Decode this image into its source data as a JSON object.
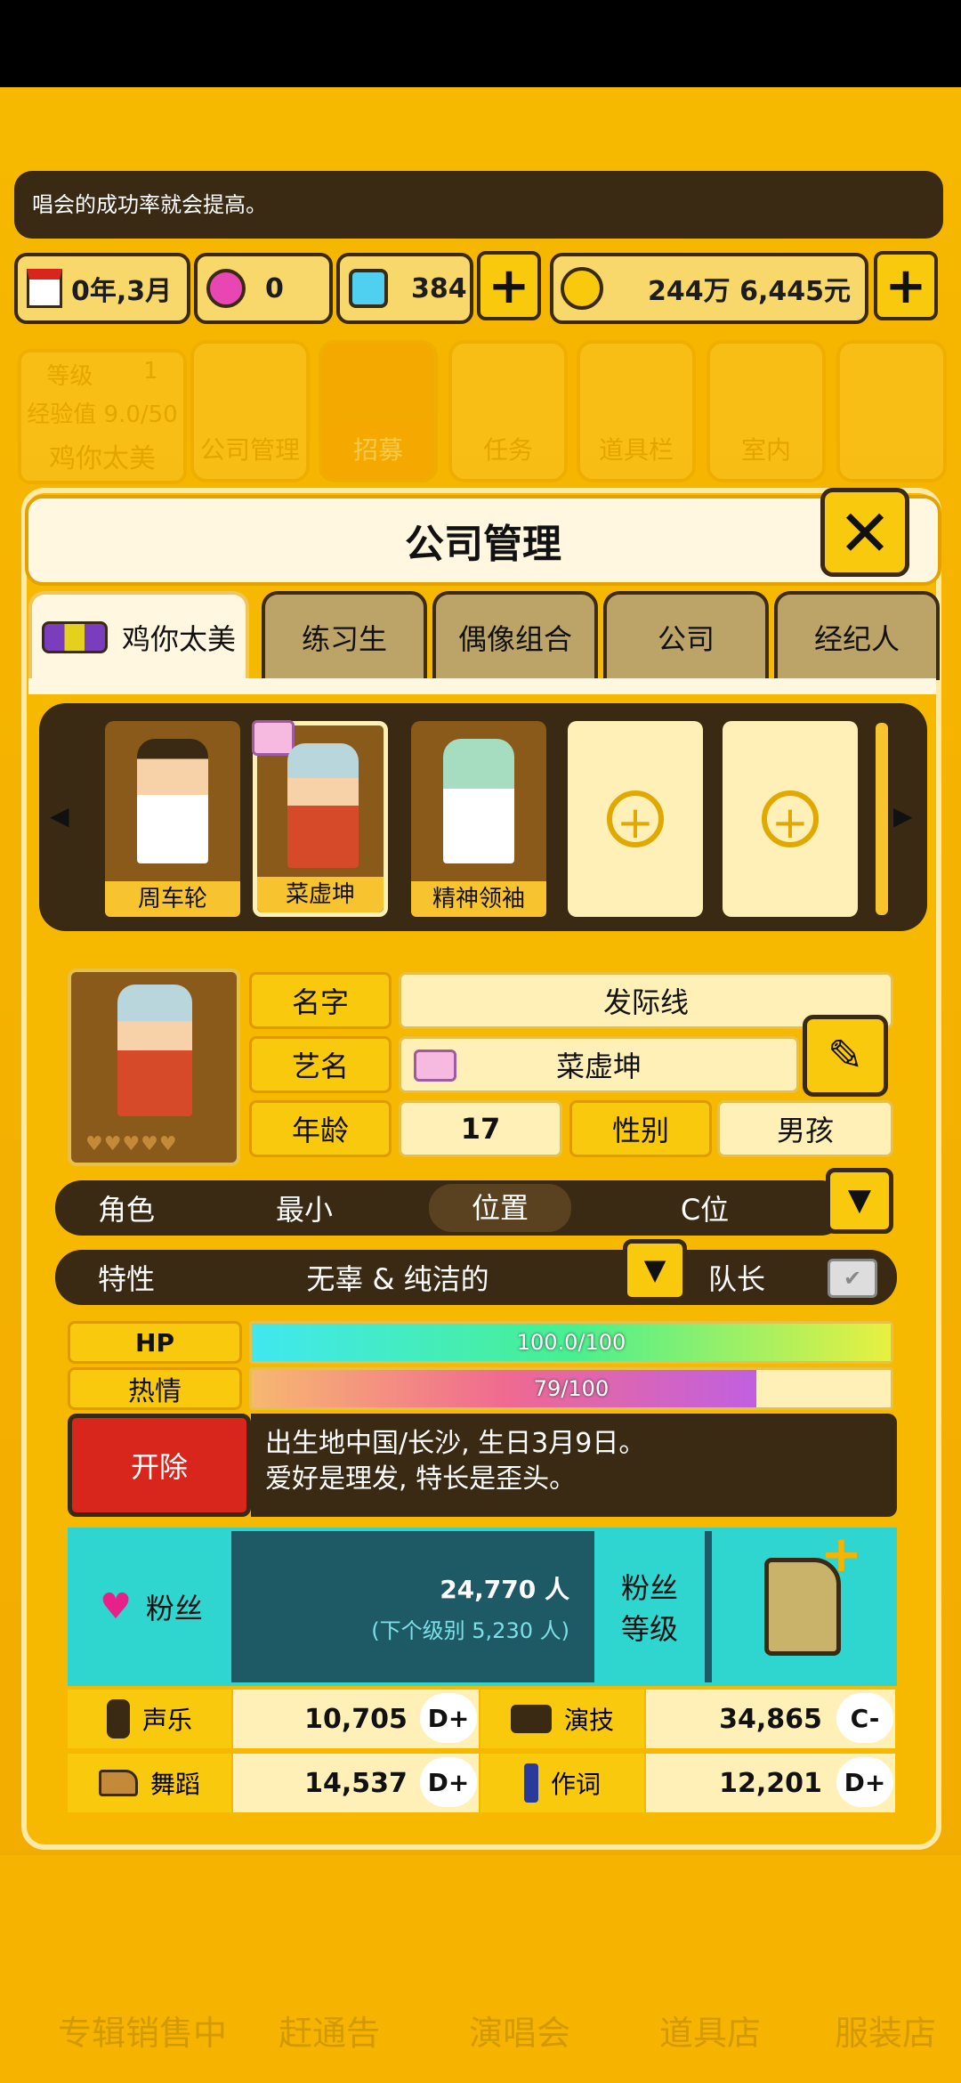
{
  "message": "唱会的成功率就会提高。",
  "status": {
    "date": "0年,3月",
    "gem_pink": "0",
    "gem_blue": "384",
    "money": "244万 6,445元"
  },
  "background_menu": {
    "level_label": "等级",
    "level_value": "1",
    "exp_label": "经验值 9.0/50",
    "company_name": "鸡你太美",
    "items": [
      "公司管理",
      "招募",
      "任务",
      "道具栏",
      "室内"
    ]
  },
  "dialog": {
    "title": "公司管理",
    "tabs": [
      "鸡你太美",
      "练习生",
      "偶像组合",
      "公司",
      "经纪人"
    ]
  },
  "members": [
    {
      "name": "周车轮"
    },
    {
      "name": "菜虚坤"
    },
    {
      "name": "精神领袖"
    }
  ],
  "profile": {
    "name_label": "名字",
    "name_value": "发际线",
    "stage_label": "艺名",
    "stage_value": "菜虚坤",
    "age_label": "年龄",
    "age_value": "17",
    "gender_label": "性别",
    "gender_value": "男孩",
    "role_label": "角色",
    "role_value": "最小",
    "position_label": "位置",
    "position_value": "C位",
    "trait_label": "特性",
    "trait_value": "无辜 & 纯洁的",
    "leader_label": "队长"
  },
  "bars": {
    "hp_label": "HP",
    "hp_text": "100.0/100",
    "hp_fraction": 1.0,
    "passion_label": "热情",
    "passion_text": "79/100",
    "passion_fraction": 0.79
  },
  "fire_button": "开除",
  "bio": {
    "line1": "出生地中国/长沙, 生日3月9日。",
    "line2": "爱好是理发, 特长是歪头。"
  },
  "fans": {
    "label": "粉丝",
    "count": "24,770 人",
    "next_level": "(下个级别 5,230 人)",
    "level_label_1": "粉丝",
    "level_label_2": "等级"
  },
  "skills": [
    {
      "name": "声乐",
      "value": "10,705",
      "grade": "D+"
    },
    {
      "name": "演技",
      "value": "34,865",
      "grade": "C-"
    },
    {
      "name": "舞蹈",
      "value": "14,537",
      "grade": "D+"
    },
    {
      "name": "作词",
      "value": "12,201",
      "grade": "D+"
    }
  ],
  "bottom_nav": [
    "专辑销售中",
    "赶通告",
    "演唱会",
    "道具店",
    "服装店"
  ],
  "colors": {
    "accent": "#f9c90d",
    "dark": "#3a2a14",
    "fire": "#d9261c",
    "fans": "#2ed6cf"
  }
}
